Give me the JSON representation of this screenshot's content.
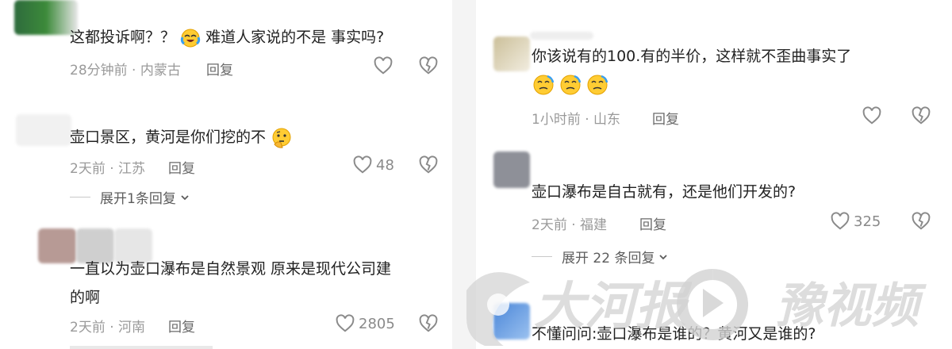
{
  "left": {
    "comments": [
      {
        "text": "这都投诉啊？？",
        "text_tail": "难道人家说的不是 事实吗?",
        "time": "28分钟前 · 内蒙古",
        "reply": "回复"
      },
      {
        "text": "壶口景区，黄河是你们挖的不",
        "time": "2天前 · 江苏",
        "reply": "回复",
        "likes": "48",
        "expand": "展开1条回复"
      },
      {
        "text_line1": "一直以为壶口瀑布是自然景观   原来是现代公司建",
        "text_line2": "的啊",
        "time": "2天前 · 河南",
        "reply": "回复",
        "likes": "2805"
      }
    ]
  },
  "right": {
    "comments": [
      {
        "text": "你该说有的100.有的半价，这样就不歪曲事实了",
        "time": "1小时前 · 山东",
        "reply": "回复"
      },
      {
        "text": "壶口瀑布是自古就有，还是他们开发的?",
        "time": "2天前 · 福建",
        "reply": "回复",
        "likes": "325",
        "expand": "展开 22 条回复"
      },
      {
        "text": "不懂问问:壶口瀑布是谁的？黄河又是谁的?"
      }
    ]
  },
  "watermark": {
    "brand1": "大河报",
    "brand2": "豫视频"
  },
  "colors": {
    "text": "#222222",
    "meta": "#9a9a9a",
    "icon": "#8a8a8a",
    "watermark": "#d2d2d2"
  }
}
